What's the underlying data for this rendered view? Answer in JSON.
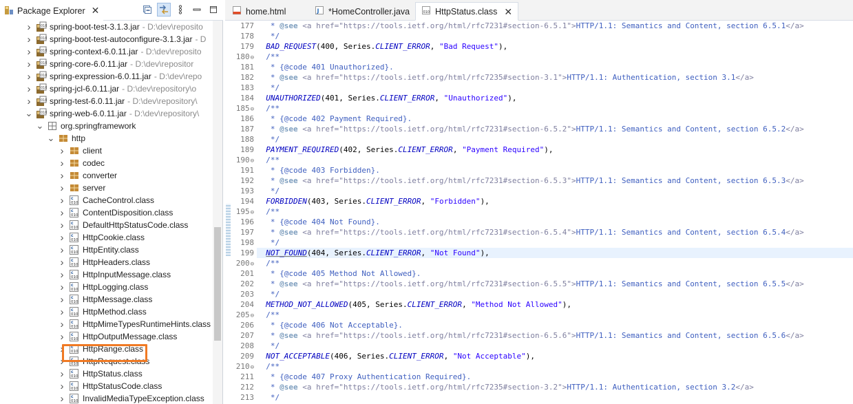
{
  "explorer": {
    "title": "Package Explorer",
    "close_glyph": "✕",
    "toolbar_icons": [
      "collapse-all-icon",
      "link-with-editor-icon",
      "view-menu-icon",
      "minimize-icon",
      "maximize-icon"
    ],
    "rows": [
      {
        "label": "spring-boot-test-3.1.3.jar",
        "decoration": "- D:\\dev\\reposito",
        "indent": 36,
        "icon": "jar",
        "expanded": false
      },
      {
        "label": "spring-boot-test-autoconfigure-3.1.3.jar",
        "decoration": "- D",
        "indent": 36,
        "icon": "jar",
        "expanded": false
      },
      {
        "label": "spring-context-6.0.11.jar",
        "decoration": "- D:\\dev\\reposito",
        "indent": 36,
        "icon": "jar",
        "expanded": false
      },
      {
        "label": "spring-core-6.0.11.jar",
        "decoration": "- D:\\dev\\repositor",
        "indent": 36,
        "icon": "jar",
        "expanded": false
      },
      {
        "label": "spring-expression-6.0.11.jar",
        "decoration": "- D:\\dev\\repo",
        "indent": 36,
        "icon": "jar",
        "expanded": false
      },
      {
        "label": "spring-jcl-6.0.11.jar",
        "decoration": "- D:\\dev\\repository\\o",
        "indent": 36,
        "icon": "jar",
        "expanded": false
      },
      {
        "label": "spring-test-6.0.11.jar",
        "decoration": "- D:\\dev\\repository\\",
        "indent": 36,
        "icon": "jar",
        "expanded": false
      },
      {
        "label": "spring-web-6.0.11.jar",
        "decoration": "- D:\\dev\\repository\\",
        "indent": 36,
        "icon": "jar",
        "expanded": true
      },
      {
        "label": "org.springframework",
        "decoration": "",
        "indent": 52,
        "icon": "folder-pkg",
        "expanded": true
      },
      {
        "label": "http",
        "decoration": "",
        "indent": 68,
        "icon": "package",
        "expanded": true
      },
      {
        "label": "client",
        "decoration": "",
        "indent": 84,
        "icon": "package",
        "expanded": false
      },
      {
        "label": "codec",
        "decoration": "",
        "indent": 84,
        "icon": "package",
        "expanded": false
      },
      {
        "label": "converter",
        "decoration": "",
        "indent": 84,
        "icon": "package",
        "expanded": false
      },
      {
        "label": "server",
        "decoration": "",
        "indent": 84,
        "icon": "package",
        "expanded": false
      },
      {
        "label": "CacheControl.class",
        "decoration": "",
        "indent": 84,
        "icon": "class",
        "expanded": false
      },
      {
        "label": "ContentDisposition.class",
        "decoration": "",
        "indent": 84,
        "icon": "class",
        "expanded": false
      },
      {
        "label": "DefaultHttpStatusCode.class",
        "decoration": "",
        "indent": 84,
        "icon": "class",
        "expanded": false
      },
      {
        "label": "HttpCookie.class",
        "decoration": "",
        "indent": 84,
        "icon": "class",
        "expanded": false
      },
      {
        "label": "HttpEntity.class",
        "decoration": "",
        "indent": 84,
        "icon": "class",
        "expanded": false
      },
      {
        "label": "HttpHeaders.class",
        "decoration": "",
        "indent": 84,
        "icon": "class",
        "expanded": false
      },
      {
        "label": "HttpInputMessage.class",
        "decoration": "",
        "indent": 84,
        "icon": "class",
        "expanded": false
      },
      {
        "label": "HttpLogging.class",
        "decoration": "",
        "indent": 84,
        "icon": "class",
        "expanded": false
      },
      {
        "label": "HttpMessage.class",
        "decoration": "",
        "indent": 84,
        "icon": "class",
        "expanded": false
      },
      {
        "label": "HttpMethod.class",
        "decoration": "",
        "indent": 84,
        "icon": "class",
        "expanded": false
      },
      {
        "label": "HttpMimeTypesRuntimeHints.class",
        "decoration": "",
        "indent": 84,
        "icon": "class",
        "expanded": false
      },
      {
        "label": "HttpOutputMessage.class",
        "decoration": "",
        "indent": 84,
        "icon": "class",
        "expanded": false
      },
      {
        "label": "HttpRange.class",
        "decoration": "",
        "indent": 84,
        "icon": "class",
        "expanded": false
      },
      {
        "label": "HttpRequest.class",
        "decoration": "",
        "indent": 84,
        "icon": "class",
        "expanded": false
      },
      {
        "label": "HttpStatus.class",
        "decoration": "",
        "indent": 84,
        "icon": "class",
        "expanded": false,
        "highlighted": true
      },
      {
        "label": "HttpStatusCode.class",
        "decoration": "",
        "indent": 84,
        "icon": "class",
        "expanded": false
      },
      {
        "label": "InvalidMediaTypeException.class",
        "decoration": "",
        "indent": 84,
        "icon": "class",
        "expanded": false
      }
    ]
  },
  "editor": {
    "tabs": [
      {
        "label": "home.html",
        "icon": "html-file-icon",
        "active": false
      },
      {
        "label": "*HomeController.java",
        "icon": "java-file-icon",
        "active": false
      },
      {
        "label": "HttpStatus.class",
        "icon": "class-file-icon",
        "active": true
      }
    ],
    "tab_close": "✕",
    "current_line": 199,
    "lines": [
      {
        "n": 177,
        "fold": false,
        "type": "see",
        "url": "https://tools.ietf.org/html/rfc7231#section-6.5.1",
        "text": "HTTP/1.1: Semantics and Content, section 6.5.1"
      },
      {
        "n": 178,
        "fold": false,
        "type": "end"
      },
      {
        "n": 179,
        "fold": false,
        "type": "enum",
        "name": "BAD_REQUEST",
        "code": "400",
        "series": "CLIENT_ERROR",
        "phrase": "\"Bad Request\""
      },
      {
        "n": 180,
        "fold": true,
        "type": "start"
      },
      {
        "n": 181,
        "fold": false,
        "type": "code",
        "text": "{@code 401 Unauthorized}."
      },
      {
        "n": 182,
        "fold": false,
        "type": "see",
        "url": "https://tools.ietf.org/html/rfc7235#section-3.1",
        "text": "HTTP/1.1: Authentication, section 3.1"
      },
      {
        "n": 183,
        "fold": false,
        "type": "end"
      },
      {
        "n": 184,
        "fold": false,
        "type": "enum",
        "name": "UNAUTHORIZED",
        "code": "401",
        "series": "CLIENT_ERROR",
        "phrase": "\"Unauthorized\""
      },
      {
        "n": 185,
        "fold": true,
        "type": "start"
      },
      {
        "n": 186,
        "fold": false,
        "type": "code",
        "text": "{@code 402 Payment Required}."
      },
      {
        "n": 187,
        "fold": false,
        "type": "see",
        "url": "https://tools.ietf.org/html/rfc7231#section-6.5.2",
        "text": "HTTP/1.1: Semantics and Content, section 6.5.2"
      },
      {
        "n": 188,
        "fold": false,
        "type": "end"
      },
      {
        "n": 189,
        "fold": false,
        "type": "enum",
        "name": "PAYMENT_REQUIRED",
        "code": "402",
        "series": "CLIENT_ERROR",
        "phrase": "\"Payment Required\""
      },
      {
        "n": 190,
        "fold": true,
        "type": "start"
      },
      {
        "n": 191,
        "fold": false,
        "type": "code",
        "text": "{@code 403 Forbidden}."
      },
      {
        "n": 192,
        "fold": false,
        "type": "see",
        "url": "https://tools.ietf.org/html/rfc7231#section-6.5.3",
        "text": "HTTP/1.1: Semantics and Content, section 6.5.3"
      },
      {
        "n": 193,
        "fold": false,
        "type": "end"
      },
      {
        "n": 194,
        "fold": false,
        "type": "enum",
        "name": "FORBIDDEN",
        "code": "403",
        "series": "CLIENT_ERROR",
        "phrase": "\"Forbidden\""
      },
      {
        "n": 195,
        "fold": true,
        "type": "start"
      },
      {
        "n": 196,
        "fold": false,
        "type": "code",
        "text": "{@code 404 Not Found}."
      },
      {
        "n": 197,
        "fold": false,
        "type": "see",
        "url": "https://tools.ietf.org/html/rfc7231#section-6.5.4",
        "text": "HTTP/1.1: Semantics and Content, section 6.5.4"
      },
      {
        "n": 198,
        "fold": false,
        "type": "end"
      },
      {
        "n": 199,
        "fold": false,
        "type": "enum",
        "name": "NOT_FOUND",
        "code": "404",
        "series": "CLIENT_ERROR",
        "phrase": "\"Not Found\"",
        "underline": true
      },
      {
        "n": 200,
        "fold": true,
        "type": "start"
      },
      {
        "n": 201,
        "fold": false,
        "type": "code",
        "text": "{@code 405 Method Not Allowed}."
      },
      {
        "n": 202,
        "fold": false,
        "type": "see",
        "url": "https://tools.ietf.org/html/rfc7231#section-6.5.5",
        "text": "HTTP/1.1: Semantics and Content, section 6.5.5"
      },
      {
        "n": 203,
        "fold": false,
        "type": "end"
      },
      {
        "n": 204,
        "fold": false,
        "type": "enum",
        "name": "METHOD_NOT_ALLOWED",
        "code": "405",
        "series": "CLIENT_ERROR",
        "phrase": "\"Method Not Allowed\""
      },
      {
        "n": 205,
        "fold": true,
        "type": "start"
      },
      {
        "n": 206,
        "fold": false,
        "type": "code",
        "text": "{@code 406 Not Acceptable}."
      },
      {
        "n": 207,
        "fold": false,
        "type": "see",
        "url": "https://tools.ietf.org/html/rfc7231#section-6.5.6",
        "text": "HTTP/1.1: Semantics and Content, section 6.5.6"
      },
      {
        "n": 208,
        "fold": false,
        "type": "end"
      },
      {
        "n": 209,
        "fold": false,
        "type": "enum",
        "name": "NOT_ACCEPTABLE",
        "code": "406",
        "series": "CLIENT_ERROR",
        "phrase": "\"Not Acceptable\""
      },
      {
        "n": 210,
        "fold": true,
        "type": "start"
      },
      {
        "n": 211,
        "fold": false,
        "type": "code",
        "text": "{@code 407 Proxy Authentication Required}."
      },
      {
        "n": 212,
        "fold": false,
        "type": "see",
        "url": "https://tools.ietf.org/html/rfc7235#section-3.2",
        "text": "HTTP/1.1: Authentication, section 3.2"
      },
      {
        "n": 213,
        "fold": false,
        "type": "end"
      }
    ]
  },
  "colors": {
    "highlight_box": "#f07a24",
    "current_line_bg": "#e8f2fe",
    "javadoc": "#3f5fbf",
    "enum_constant": "#0000c0",
    "string": "#2a00ff"
  }
}
